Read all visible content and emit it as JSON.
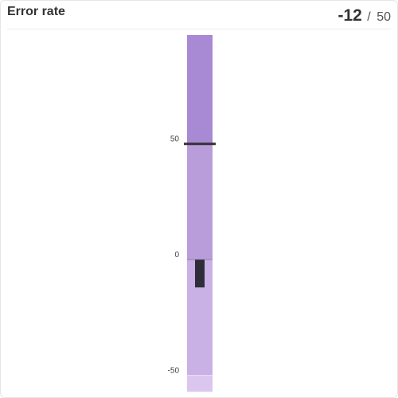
{
  "widget": {
    "title": "Error rate",
    "value": "-12",
    "separator": "/",
    "target": "50"
  },
  "chart_data": {
    "type": "bullet",
    "orientation": "vertical",
    "value": -12,
    "target": 50,
    "ticks": [
      50,
      0,
      -50
    ],
    "tick_labels": [
      "50",
      "0",
      "-50"
    ],
    "range": [
      -57,
      97
    ],
    "bands": [
      {
        "from": -57,
        "to": -50,
        "color": "#dac6ef"
      },
      {
        "from": -50,
        "to": 0,
        "color": "#c9b0e5"
      },
      {
        "from": 0,
        "to": 50,
        "color": "#b99ddb"
      },
      {
        "from": 50,
        "to": 97,
        "color": "#a889d3"
      }
    ],
    "bar_color": "#2f2d3a",
    "target_color": "#333333"
  }
}
